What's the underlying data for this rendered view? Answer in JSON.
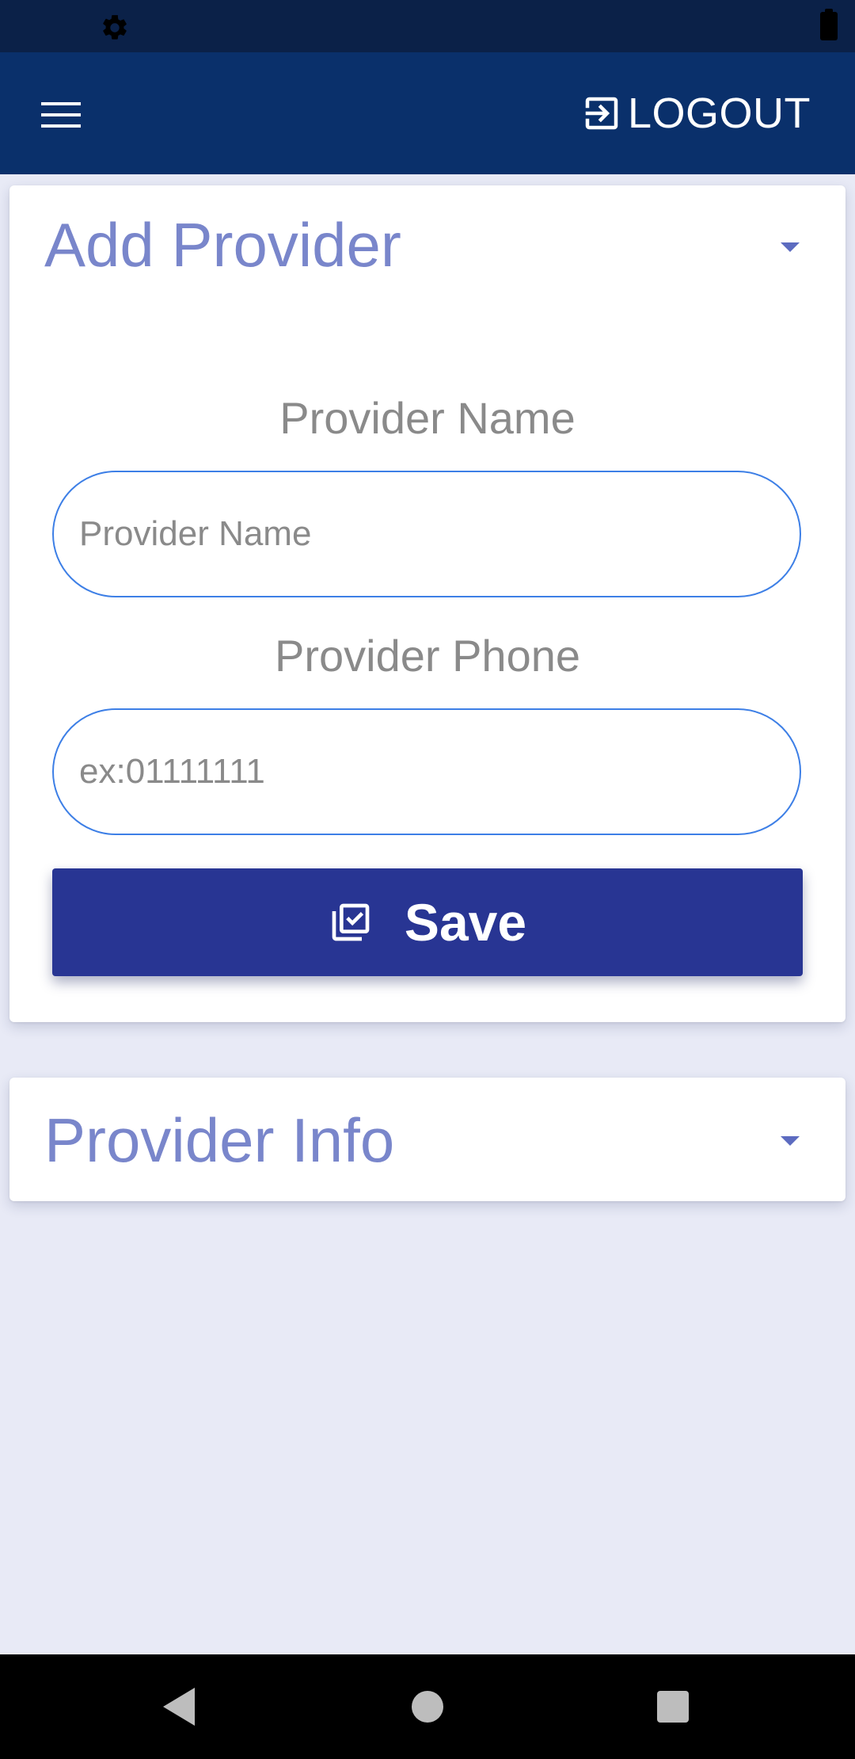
{
  "colors": {
    "status_bar": "#0b2148",
    "app_bar": "#0a306b",
    "background": "#e8eaf6",
    "card_title": "#7986cb",
    "input_border": "#3d7fe6",
    "save_button": "#283593"
  },
  "app_bar": {
    "menu_icon": "hamburger-menu-icon",
    "logout_icon": "logout-arrow-icon",
    "logout_label": "LOGOUT"
  },
  "add_provider": {
    "title": "Add Provider",
    "caret_icon": "caret-down-icon",
    "name_field": {
      "label": "Provider Name",
      "placeholder": "Provider Name",
      "value": ""
    },
    "phone_field": {
      "label": "Provider Phone",
      "placeholder": "ex:01111111",
      "value": ""
    },
    "save_button": {
      "icon": "library-add-check-icon",
      "label": "Save"
    }
  },
  "provider_info": {
    "title": "Provider Info",
    "caret_icon": "caret-down-icon"
  },
  "system_nav": {
    "back_icon": "back-triangle-icon",
    "home_icon": "home-circle-icon",
    "recents_icon": "recents-square-icon"
  }
}
